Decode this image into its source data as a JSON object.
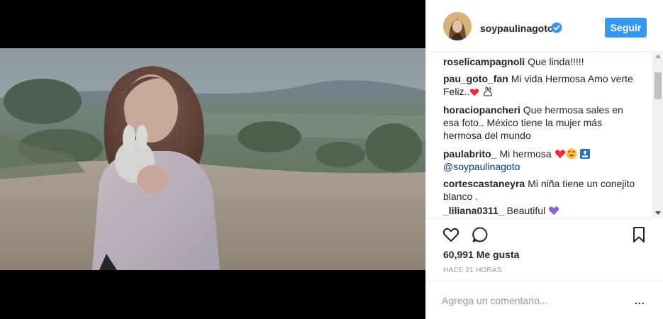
{
  "post": {
    "username": "soypaulinagoto",
    "follow_label": "Seguir",
    "likes": "60,991 Me gusta",
    "time_ago": "HACE 21 HORAS",
    "comment_placeholder": "Agrega un comentario...",
    "more": "..."
  },
  "comments": [
    {
      "user": "roselicampagnoli",
      "text": "Que linda!!!!!"
    },
    {
      "user": "pau_goto_fan",
      "text": "Mi vida Hermosa Amo verte Feliz.."
    },
    {
      "user": "horaciopancheri",
      "text": "Que hermosa sales en esa foto.. México tiene la mujer más hermosa del mundo"
    },
    {
      "user": "paulabrito_",
      "text": "Mi hermosa",
      "mention": "@soypaulinagoto"
    },
    {
      "user": "cortescastaneyra",
      "text": "Mi niña tiene un conejito blanco ."
    },
    {
      "user": "_liliana0311_",
      "text": "Beautiful"
    }
  ],
  "colors": {
    "follow_button": "#3897f0",
    "mention": "#003569",
    "heart": "#ed2a3f",
    "purple_heart": "#8a63d2"
  }
}
